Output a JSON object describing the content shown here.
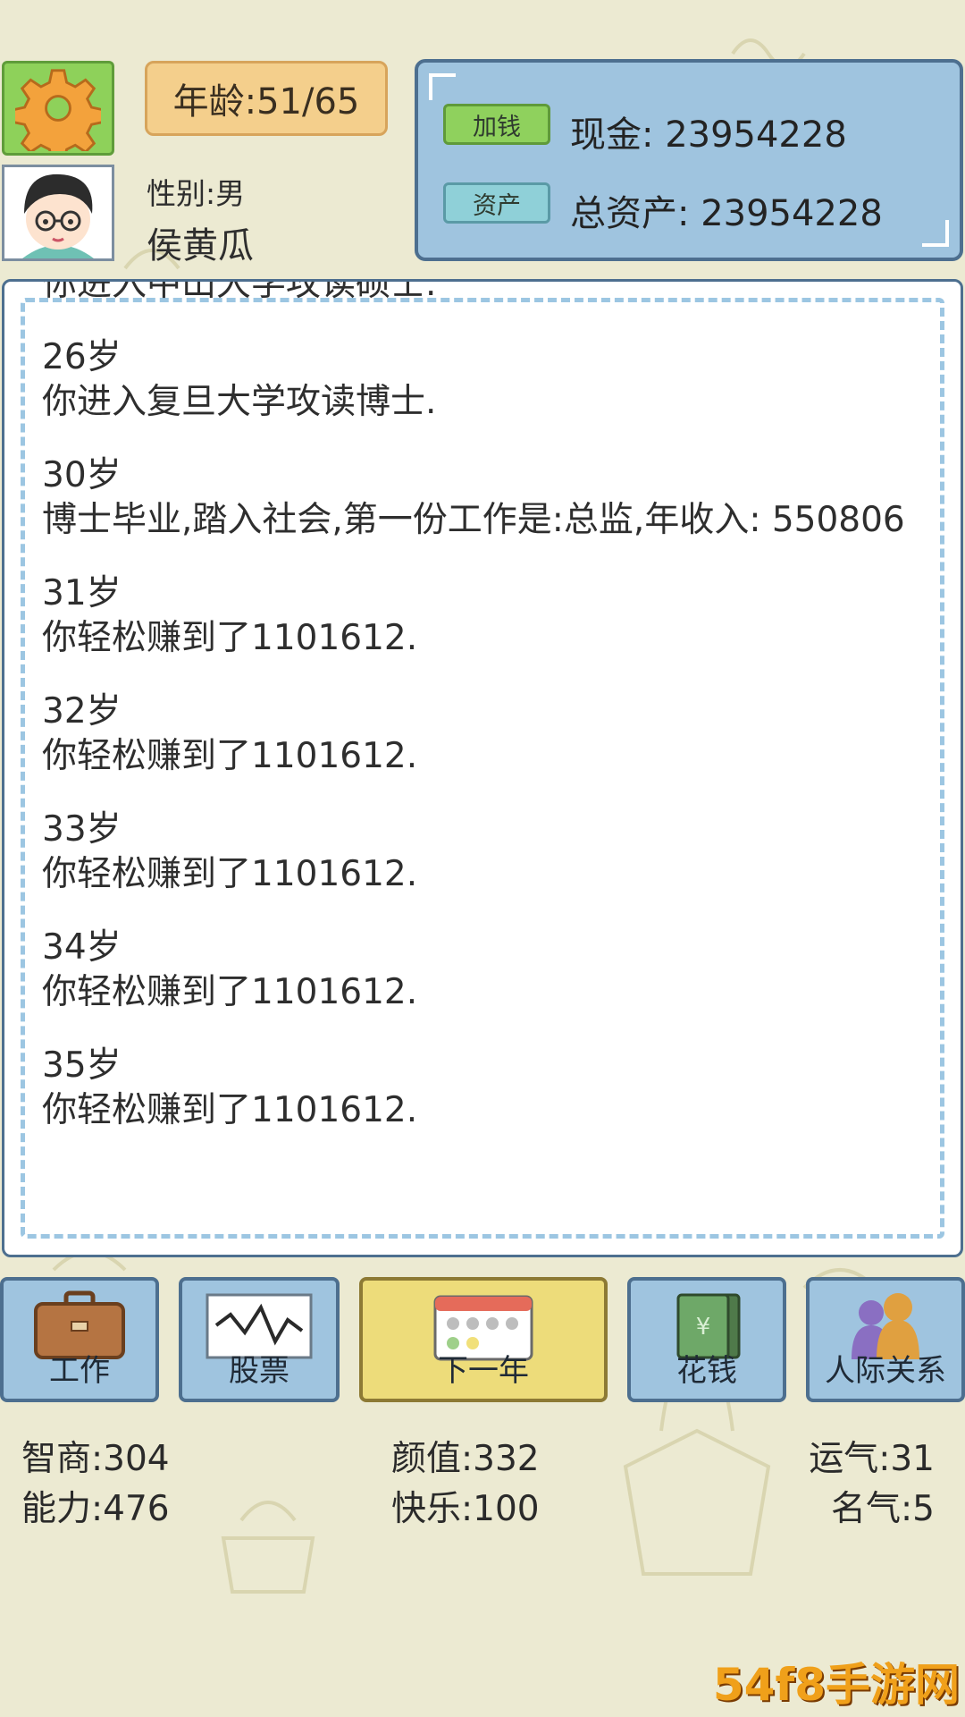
{
  "header": {
    "age_label": "年龄:51/65",
    "gender_label": "性别:男",
    "player_name": "侯黄瓜"
  },
  "money": {
    "add_money_button": "加钱",
    "assets_button": "资产",
    "cash_label": "现金: 23954228",
    "total_assets_label": "总资产: 23954228"
  },
  "log": {
    "entries": [
      {
        "age": "",
        "text": "你进入中山大学攻读硕士."
      },
      {
        "age": "26岁",
        "text": "你进入复旦大学攻读博士."
      },
      {
        "age": "30岁",
        "text": "博士毕业,踏入社会,第一份工作是:总监,年收入: 550806"
      },
      {
        "age": "31岁",
        "text": "你轻松赚到了1101612."
      },
      {
        "age": "32岁",
        "text": "你轻松赚到了1101612."
      },
      {
        "age": "33岁",
        "text": "你轻松赚到了1101612."
      },
      {
        "age": "34岁",
        "text": "你轻松赚到了1101612."
      },
      {
        "age": "35岁",
        "text": "你轻松赚到了1101612."
      }
    ]
  },
  "actions": {
    "work": "工作",
    "stocks": "股票",
    "next_year": "下一年",
    "spend": "花钱",
    "relations": "人际关系"
  },
  "stats": {
    "iq": "智商:304",
    "looks": "颜值:332",
    "luck": "运气:31",
    "ability": "能力:476",
    "happiness": "快乐:100",
    "fame": "名气:5"
  },
  "watermark": "54f8手游网"
}
